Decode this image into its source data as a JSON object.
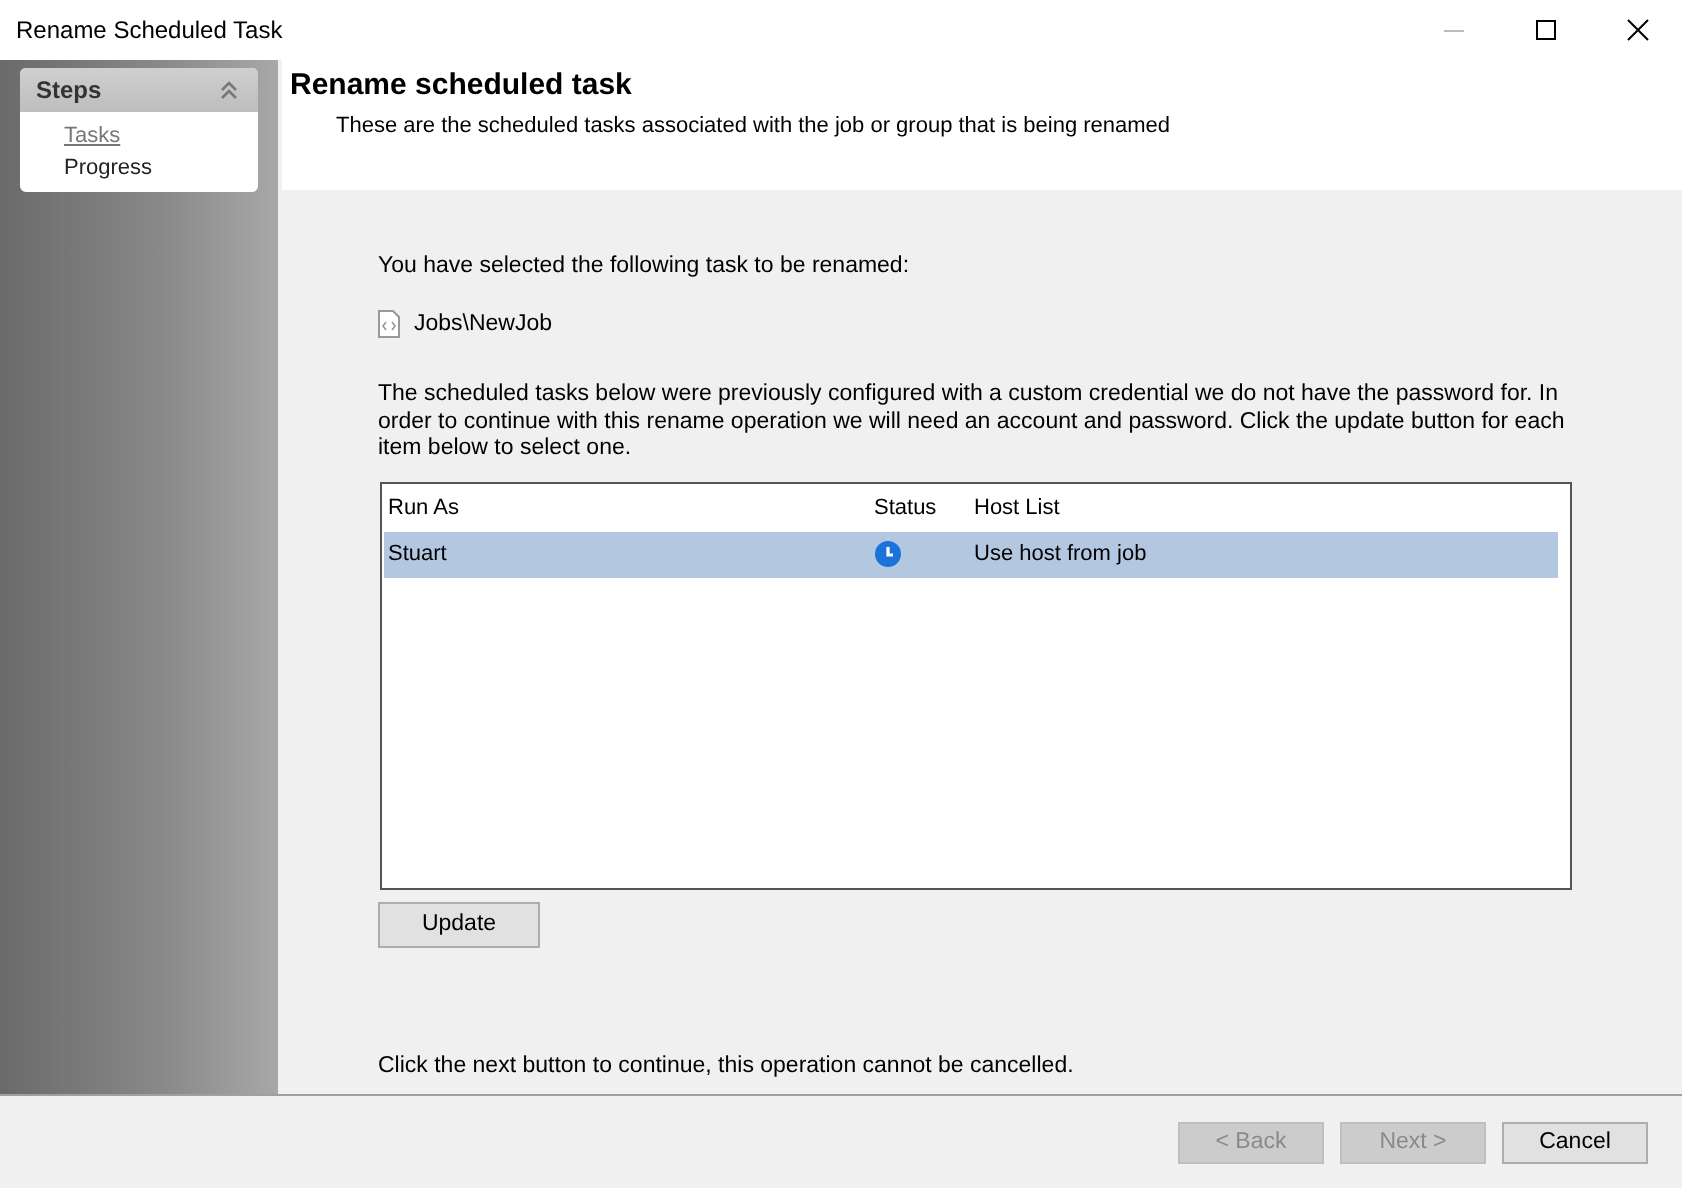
{
  "window": {
    "title": "Rename Scheduled Task"
  },
  "steps": {
    "title": "Steps",
    "expanded": true,
    "items": [
      {
        "label": "Tasks",
        "selected": true
      },
      {
        "label": "Progress",
        "selected": false
      }
    ]
  },
  "header": {
    "title": "Rename scheduled task",
    "subtitle": "These are the scheduled tasks associated with the job or group that is being renamed"
  },
  "intro": "You have selected the following task to be renamed:",
  "task_path": "Jobs\\NewJob",
  "explanation": "The scheduled tasks below were previously configured with a custom credential we do not have the password for. In order to continue with this rename operation we will need an account and password. Click the update button for each item below to select one.",
  "table": {
    "columns": [
      "Run As",
      "Status",
      "Host List"
    ],
    "rows": [
      {
        "run_as": "Stuart",
        "kind": "scheduled",
        "host_list": "Use host from job",
        "selected": true
      }
    ]
  },
  "update_button": "Update",
  "footer_note": "Click the next button to continue, this operation cannot be cancelled.",
  "buttons": [
    {
      "label": "< Back",
      "disabled": true
    },
    {
      "label": "Next >",
      "disabled": true
    },
    {
      "label": "Cancel",
      "disabled": false
    }
  ]
}
